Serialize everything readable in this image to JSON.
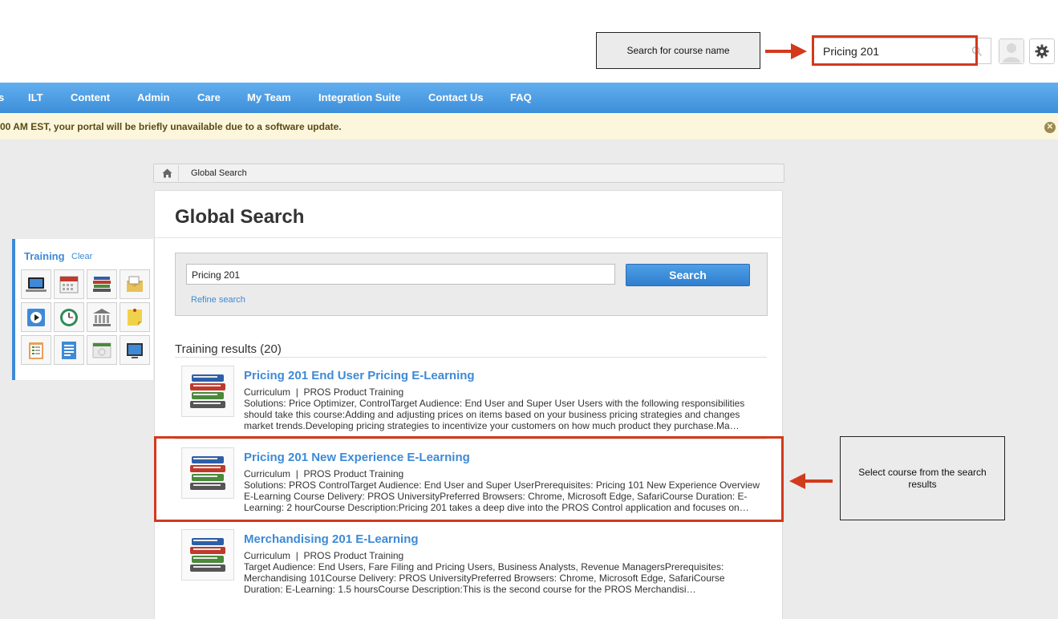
{
  "annotations": {
    "top_callout": "Search for course name",
    "side_callout": "Select course from the search results",
    "highlight_color": "#d23a1c"
  },
  "header": {
    "search_value": "Pricing 201"
  },
  "nav": {
    "items": [
      "s",
      "ILT",
      "Content",
      "Admin",
      "Care",
      "My Team",
      "Integration Suite",
      "Contact Us",
      "FAQ"
    ]
  },
  "banner": {
    "text": "00 AM EST, your portal will be briefly unavailable due to a software update."
  },
  "breadcrumb": {
    "current": "Global Search"
  },
  "main": {
    "title": "Global Search",
    "search": {
      "value": "Pricing 201",
      "button_label": "Search",
      "refine_label": "Refine search"
    },
    "results_heading": "Training results (20)",
    "results": [
      {
        "title": "Pricing 201 End User Pricing E-Learning",
        "type": "Curriculum",
        "separator": "|",
        "provider": "PROS Product Training",
        "description": "Solutions: Price Optimizer, ControlTarget Audience: End User and Super User Users with the following responsibilities should take this course:Adding and adjusting prices on items based on your business pricing strategies and changes market trends.Developing pricing strategies to incentivize your customers on how much product they purchase.Ma…"
      },
      {
        "title": "Pricing 201 New Experience E-Learning",
        "type": "Curriculum",
        "separator": "|",
        "provider": "PROS Product Training",
        "description": "Solutions: PROS ControlTarget Audience: End User and Super UserPrerequisites: Pricing 101 New Experience Overview E-Learning Course Delivery: PROS UniversityPreferred Browsers: Chrome, Microsoft Edge, SafariCourse Duration: E-Learning: 2 hourCourse Description:Pricing 201 takes a deep dive into the PROS Control application and focuses on…"
      },
      {
        "title": "Merchandising 201 E-Learning",
        "type": "Curriculum",
        "separator": "|",
        "provider": "PROS Product Training",
        "description": "Target Audience: End Users, Fare Filing and Pricing Users, Business Analysts, Revenue ManagersPrerequisites: Merchandising 101Course Delivery: PROS UniversityPreferred Browsers: Chrome, Microsoft Edge, SafariCourse Duration: E-Learning: 1.5 hoursCourse Description:This is the second course for the PROS Merchandisi…"
      }
    ]
  },
  "sidebar": {
    "title": "Training",
    "clear_label": "Clear",
    "icons": [
      "laptop-icon",
      "calendar-icon",
      "books-icon",
      "envelope-icon",
      "video-icon",
      "clock-icon",
      "library-icon",
      "note-icon",
      "checklist-icon",
      "document-icon",
      "web-page-icon",
      "monitor-icon"
    ]
  },
  "colors": {
    "nav_blue": "#3d8fd9",
    "link_blue": "#3e8ad6",
    "banner_bg": "#fbf6dc"
  }
}
